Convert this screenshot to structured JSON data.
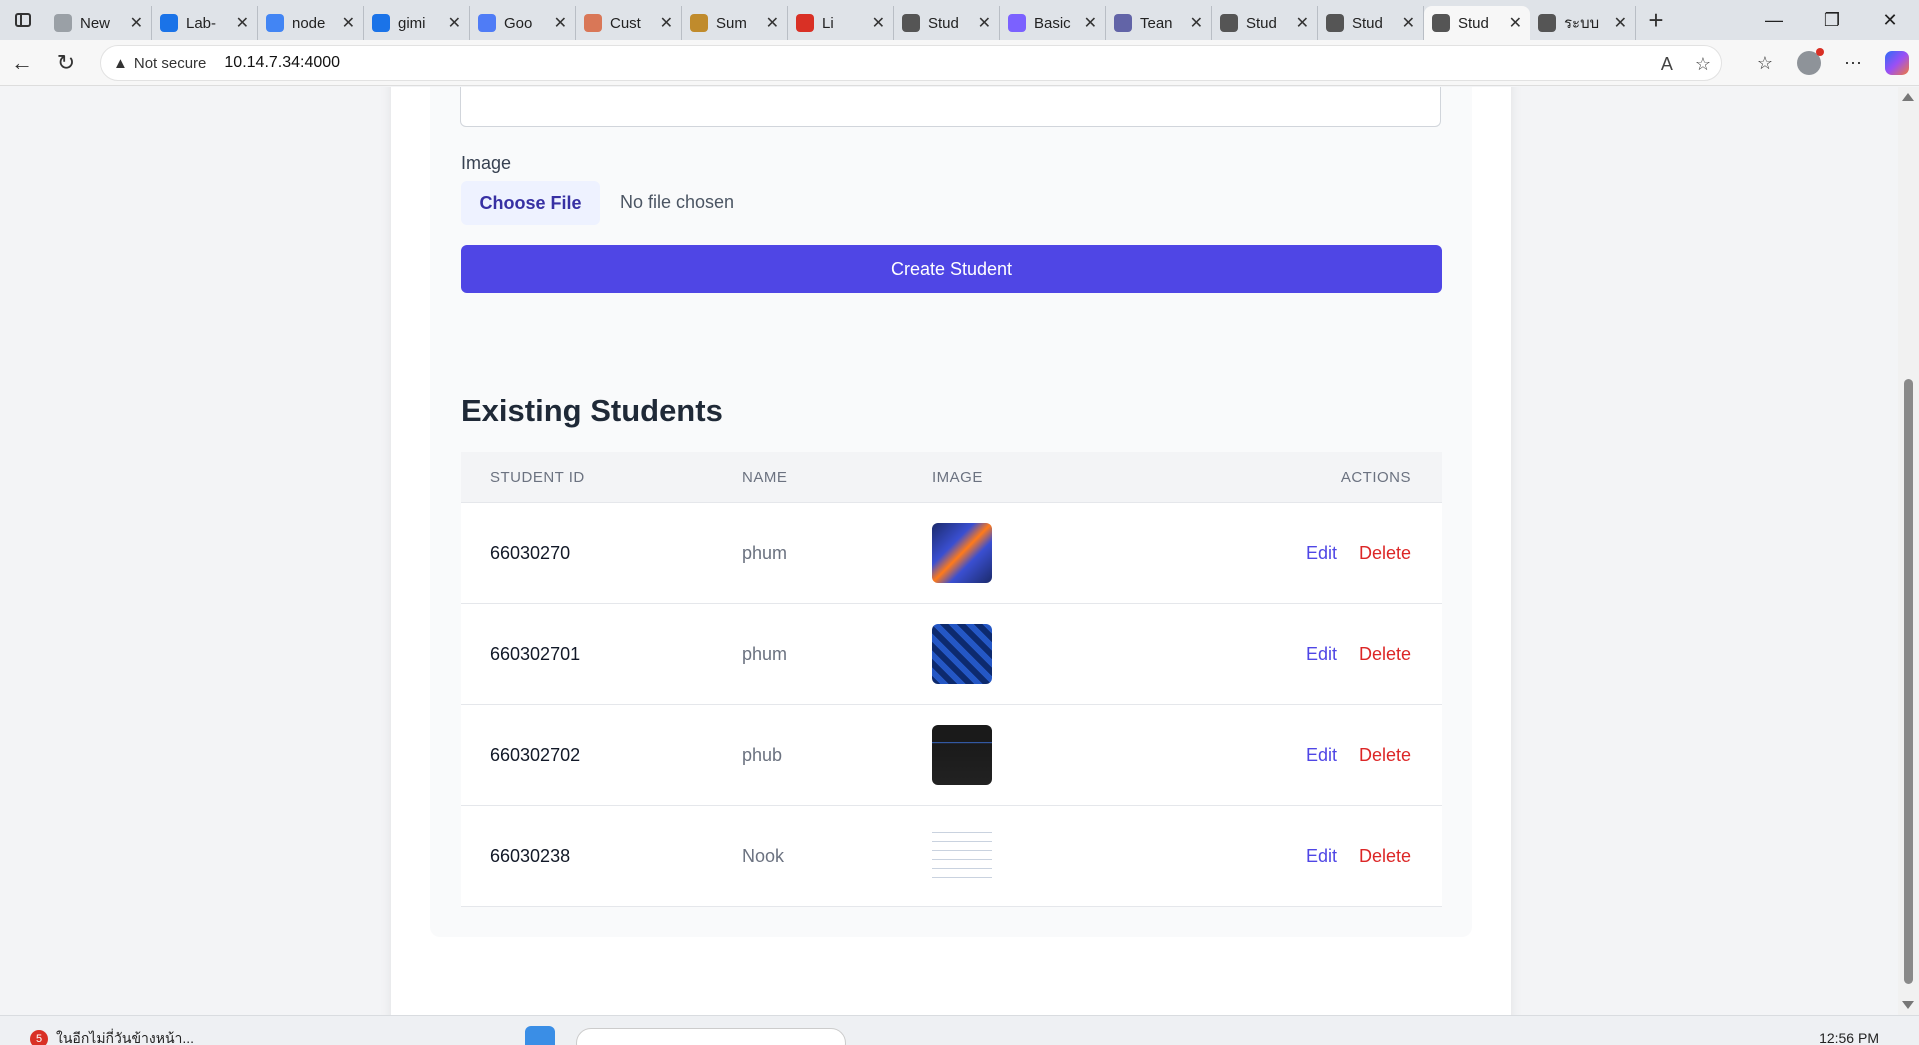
{
  "browser": {
    "tabs": [
      {
        "title": "New",
        "icon_color": "#9aa0a6"
      },
      {
        "title": "Lab-",
        "icon_color": "#1a73e8"
      },
      {
        "title": "node",
        "icon_color": "#4285f4"
      },
      {
        "title": "gimi",
        "icon_color": "#1a73e8"
      },
      {
        "title": "Goo",
        "icon_color": "#4f7cf6"
      },
      {
        "title": "Cust",
        "icon_color": "#d97757"
      },
      {
        "title": "Sum",
        "icon_color": "#c08b2c"
      },
      {
        "title": "Li",
        "icon_color": "#d93025"
      },
      {
        "title": "Stud",
        "icon_color": "#555555"
      },
      {
        "title": "Basic",
        "icon_color": "#7b61ff"
      },
      {
        "title": "Tean",
        "icon_color": "#6264a7"
      },
      {
        "title": "Stud",
        "icon_color": "#555555"
      },
      {
        "title": "Stud",
        "icon_color": "#555555"
      },
      {
        "title": "Stud",
        "icon_color": "#555555",
        "active": true
      },
      {
        "title": "ระบบ",
        "icon_color": "#555555"
      }
    ],
    "security_label": "Not secure",
    "url": "10.14.7.34:4000"
  },
  "form": {
    "image_label": "Image",
    "choose_file_label": "Choose File",
    "no_file_text": "No file chosen",
    "submit_label": "Create Student"
  },
  "students_section": {
    "title": "Existing Students",
    "columns": [
      "STUDENT ID",
      "NAME",
      "IMAGE",
      "ACTIONS"
    ],
    "rows": [
      {
        "id": "66030270",
        "name": "phum",
        "thumb": "orange-blue"
      },
      {
        "id": "660302701",
        "name": "phum",
        "thumb": "blue-grid"
      },
      {
        "id": "660302702",
        "name": "phub",
        "thumb": "dark"
      },
      {
        "id": "66030238",
        "name": "Nook",
        "thumb": "diagram"
      }
    ],
    "edit_label": "Edit",
    "delete_label": "Delete"
  },
  "taskbar": {
    "notification_count": "5",
    "notification_text": "ในอีกไม่กี่วันข้างหน้า...",
    "clock": "12:56 PM"
  },
  "colors": {
    "primary": "#4f46e5",
    "danger": "#dc2626",
    "chooser_bg": "#eef2ff"
  }
}
